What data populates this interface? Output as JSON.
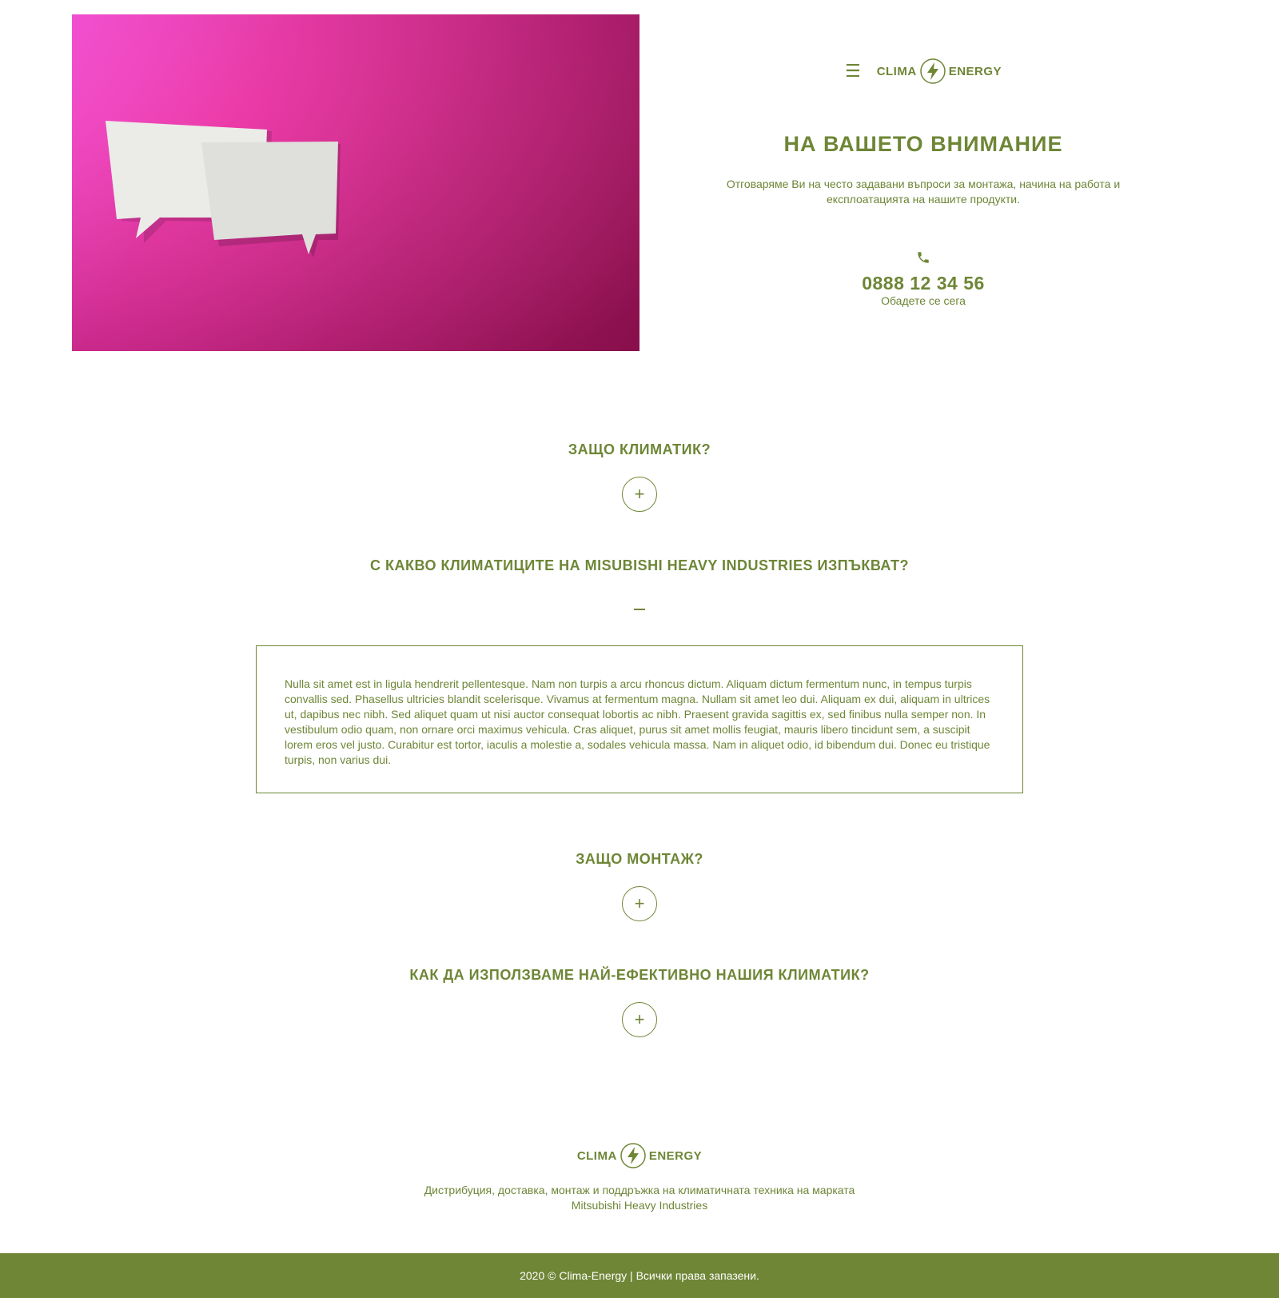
{
  "brand": {
    "name_left": "CLIMA",
    "name_right": "ENERGY",
    "color": "#6e8636"
  },
  "header": {
    "menu_icon": "hamburger-icon",
    "title": "НА ВАШЕТО ВНИМАНИЕ",
    "description": "Отговаряме Ви на често задавани въпроси за монтажа, начина на работа и експлоатацията на нашите продукти.",
    "phone_icon": "phone-icon",
    "phone_number": "0888 12 34 56",
    "phone_label": "Обадете се сега"
  },
  "hero_image": {
    "subject": "two paper speech bubbles on magenta background",
    "colors": [
      "#ff47d9",
      "#a6135c"
    ]
  },
  "faq": {
    "items": [
      {
        "question": "ЗАЩО КЛИМАТИК?",
        "expanded": false,
        "toggle": "+"
      },
      {
        "question": "С КАКВО КЛИМАТИЦИТЕ НА MISUBISHI HEAVY INDUSTRIES ИЗПЪКВАТ?",
        "expanded": true,
        "toggle": "–",
        "answer": "Nulla sit amet est in ligula hendrerit pellentesque. Nam non turpis a arcu rhoncus dictum. Aliquam dictum fermentum nunc, in tempus turpis convallis sed. Phasellus ultricies blandit scelerisque. Vivamus at fermentum magna. Nullam sit amet leo dui. Aliquam ex dui, aliquam in ultrices ut, dapibus nec nibh. Sed aliquet quam ut nisi auctor consequat lobortis ac nibh. Praesent gravida sagittis ex, sed finibus nulla semper non. In vestibulum odio quam, non ornare orci maximus vehicula. Cras aliquet, purus sit amet mollis feugiat, mauris libero tincidunt sem, a suscipit lorem eros vel justo. Curabitur est tortor, iaculis a molestie a, sodales vehicula massa. Nam in aliquet odio, id bibendum dui. Donec eu tristique turpis, non varius dui."
      },
      {
        "question": "ЗАЩО МОНТАЖ?",
        "expanded": false,
        "toggle": "+"
      },
      {
        "question": "КАК ДА ИЗПОЛЗВАМЕ НАЙ-ЕФЕКТИВНО НАШИЯ КЛИМАТИК?",
        "expanded": false,
        "toggle": "+"
      }
    ]
  },
  "footer": {
    "description": "Дистрибуция, доставка, монтаж и поддръжка на климатичната техника на марката Mitsubishi Heavy Industries",
    "copyright": "2020 © Clima-Energy | Всички права запазени."
  }
}
